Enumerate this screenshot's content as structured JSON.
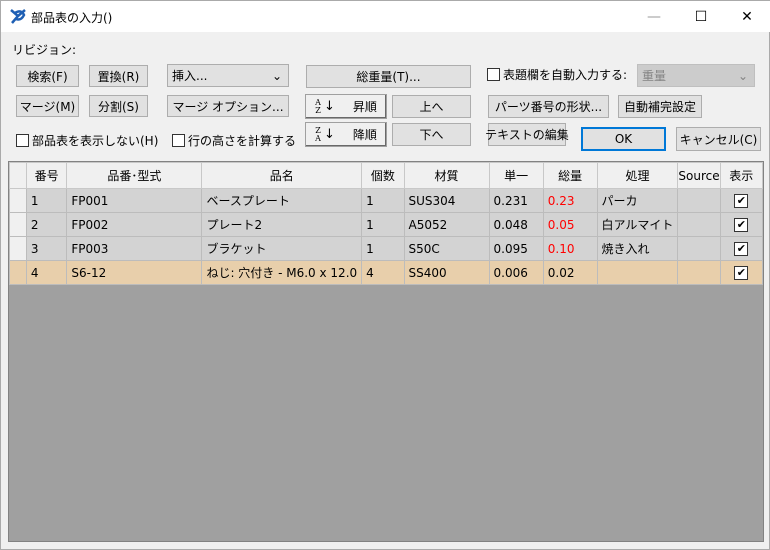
{
  "window": {
    "title": "部品表の入力()",
    "minimize": "—",
    "maximize": "☐",
    "close": "✕"
  },
  "revision_label": "リビジョン:",
  "buttons": {
    "search": "検索(F)",
    "replace": "置換(R)",
    "merge": "マージ(M)",
    "split": "分割(S)",
    "merge_options": "マージ オプション...",
    "total_weight": "総重量(T)...",
    "ascending": "昇順",
    "descending": "降順",
    "up": "上へ",
    "down": "下へ",
    "part_number_format": "パーツ番号の形状...",
    "autocomplete_settings": "自動補完設定",
    "edit_text": "テキストの編集",
    "ok": "OK",
    "cancel": "キャンセル(C)"
  },
  "insert_combo": {
    "value": "挿入..."
  },
  "title_block_checkbox": {
    "label": "表題欄を自動入力する:",
    "checked": false
  },
  "title_block_combo": {
    "value": "重量",
    "disabled": true
  },
  "hide_bom_checkbox": {
    "label": "部品表を表示しない(H)",
    "checked": false
  },
  "row_height_checkbox": {
    "label": "行の高さを計算する",
    "checked": false
  },
  "sort_icons": {
    "asc_top": "A",
    "asc_bottom": "Z",
    "desc_top": "Z",
    "desc_bottom": "A",
    "arrow": "↓"
  },
  "table": {
    "columns": [
      "番号",
      "品番･型式",
      "品名",
      "個数",
      "材質",
      "単一",
      "総量",
      "処理",
      "Source",
      "表示"
    ],
    "rows": [
      {
        "cells": [
          "1",
          "FP001",
          "ベースプレート",
          "1",
          "SUS304",
          "0.231",
          "0.23",
          "パーカ",
          ""
        ],
        "visible": true,
        "total_red": true,
        "selected": false
      },
      {
        "cells": [
          "2",
          "FP002",
          "プレート2",
          "1",
          "A5052",
          "0.048",
          "0.05",
          "白アルマイト",
          ""
        ],
        "visible": true,
        "total_red": true,
        "selected": false
      },
      {
        "cells": [
          "3",
          "FP003",
          "ブラケット",
          "1",
          "S50C",
          "0.095",
          "0.10",
          "焼き入れ",
          ""
        ],
        "visible": true,
        "total_red": true,
        "selected": false
      },
      {
        "cells": [
          "4",
          "S6-12",
          "ねじ: 穴付き - M6.0 x 12.0",
          "4",
          "SS400",
          "0.006",
          "0.02",
          "",
          ""
        ],
        "visible": true,
        "total_red": false,
        "selected": true
      }
    ]
  },
  "colors": {
    "selected_row": "#e8cfab",
    "row": "#d3d3d3",
    "warning_text": "#ff0000",
    "ok_border": "#0078d7",
    "grid_empty": "#a0a0a0"
  }
}
